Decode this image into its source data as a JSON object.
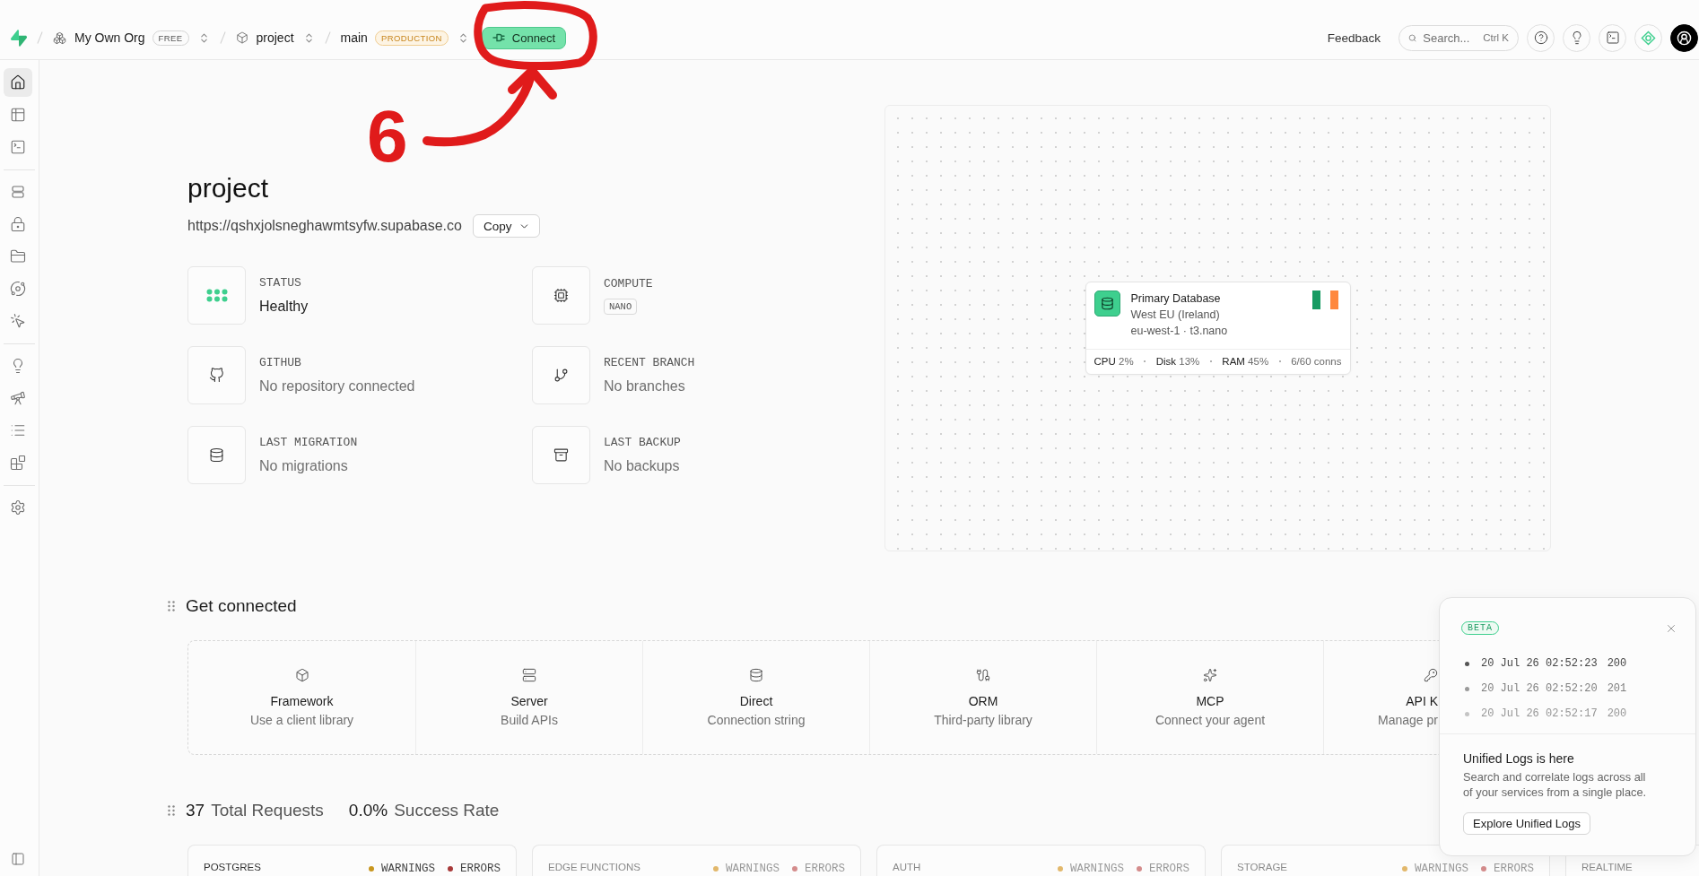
{
  "topbar": {
    "org": {
      "name": "My Own Org",
      "plan": "FREE"
    },
    "project": "project",
    "branch": {
      "name": "main",
      "environment": "PRODUCTION"
    },
    "connect_button": "Connect",
    "feedback": "Feedback",
    "search": {
      "placeholder": "Search...",
      "shortcut": "Ctrl K"
    }
  },
  "annotation": {
    "label": "6"
  },
  "sidebar": {
    "groups": [
      {
        "items": [
          {
            "selected": true
          },
          {
            "selected": false
          },
          {
            "selected": false
          }
        ]
      },
      {
        "items": [
          {
            "selected": false
          },
          {
            "selected": false
          },
          {
            "selected": false
          },
          {
            "selected": false
          },
          {
            "selected": false
          }
        ]
      },
      {
        "items": [
          {
            "selected": false
          },
          {
            "selected": false
          },
          {
            "selected": false
          },
          {
            "selected": false
          }
        ]
      },
      {
        "items": [
          {
            "selected": false
          }
        ]
      }
    ]
  },
  "project": {
    "title": "project",
    "url": "https://qshxjolsneghawmtsyfw.supabase.co",
    "copy_button": "Copy",
    "info": [
      {
        "kind": "status",
        "label": "STATUS",
        "value": "Healthy"
      },
      {
        "kind": "compute",
        "label": "COMPUTE",
        "badge": "NANO"
      },
      {
        "kind": "github",
        "label": "GITHUB",
        "value": "No repository connected"
      },
      {
        "kind": "branch",
        "label": "RECENT BRANCH",
        "value": "No branches"
      },
      {
        "kind": "migration",
        "label": "LAST MIGRATION",
        "value": "No migrations"
      },
      {
        "kind": "backup",
        "label": "LAST BACKUP",
        "value": "No backups"
      }
    ]
  },
  "database_card": {
    "title": "Primary Database",
    "region": "West EU (Ireland)",
    "detail": "eu-west-1 · t3.nano",
    "stats": [
      {
        "label": "CPU",
        "value": "2%"
      },
      {
        "label": "Disk",
        "value": "13%"
      },
      {
        "label": "RAM",
        "value": "45%"
      },
      {
        "value": "6/60 conns"
      }
    ]
  },
  "get_connected": {
    "title": "Get connected",
    "options": [
      {
        "title": "Framework",
        "description": "Use a client library",
        "cut": false
      },
      {
        "title": "Server",
        "description": "Build APIs",
        "cut": false
      },
      {
        "title": "Direct",
        "description": "Connection string",
        "cut": false
      },
      {
        "title": "ORM",
        "description": "Third-party library",
        "cut": false
      },
      {
        "title": "MCP",
        "description": "Connect your agent",
        "cut": false
      },
      {
        "title": "API K",
        "description": "Manage pr",
        "cut": true
      }
    ]
  },
  "requests": {
    "total": "37",
    "total_label": "Total Requests",
    "rate": "0.0%",
    "rate_label": "Success Rate",
    "services": [
      {
        "name": "POSTGRES",
        "dimmed": false,
        "legend": [
          {
            "label": "WARNINGS",
            "color": "#c8961e"
          },
          {
            "label": "ERRORS",
            "color": "#a83a3a"
          }
        ]
      },
      {
        "name": "EDGE FUNCTIONS",
        "dimmed": true,
        "legend": [
          {
            "label": "WARNINGS",
            "color": "#e2b86c"
          },
          {
            "label": "ERRORS",
            "color": "#d48c8c"
          }
        ]
      },
      {
        "name": "AUTH",
        "dimmed": true,
        "legend": [
          {
            "label": "WARNINGS",
            "color": "#e2b86c"
          },
          {
            "label": "ERRORS",
            "color": "#d48c8c"
          }
        ]
      },
      {
        "name": "STORAGE",
        "dimmed": true,
        "legend": [
          {
            "label": "WARNINGS",
            "color": "#e2b86c"
          },
          {
            "label": "ERRORS",
            "color": "#d48c8c"
          }
        ]
      },
      {
        "name": "REALTIME",
        "dimmed": true
      }
    ]
  },
  "logs_popup": {
    "badge": "BETA",
    "logs": [
      {
        "time": "20 Jul 26 02:52:23",
        "code": "200"
      },
      {
        "time": "20 Jul 26 02:52:20",
        "code": "201"
      },
      {
        "time": "20 Jul 26 02:52:17",
        "code": "200"
      }
    ],
    "title": "Unified Logs is here",
    "description": "Search and correlate logs across all of your services from a single place.",
    "button": "Explore Unified Logs"
  }
}
